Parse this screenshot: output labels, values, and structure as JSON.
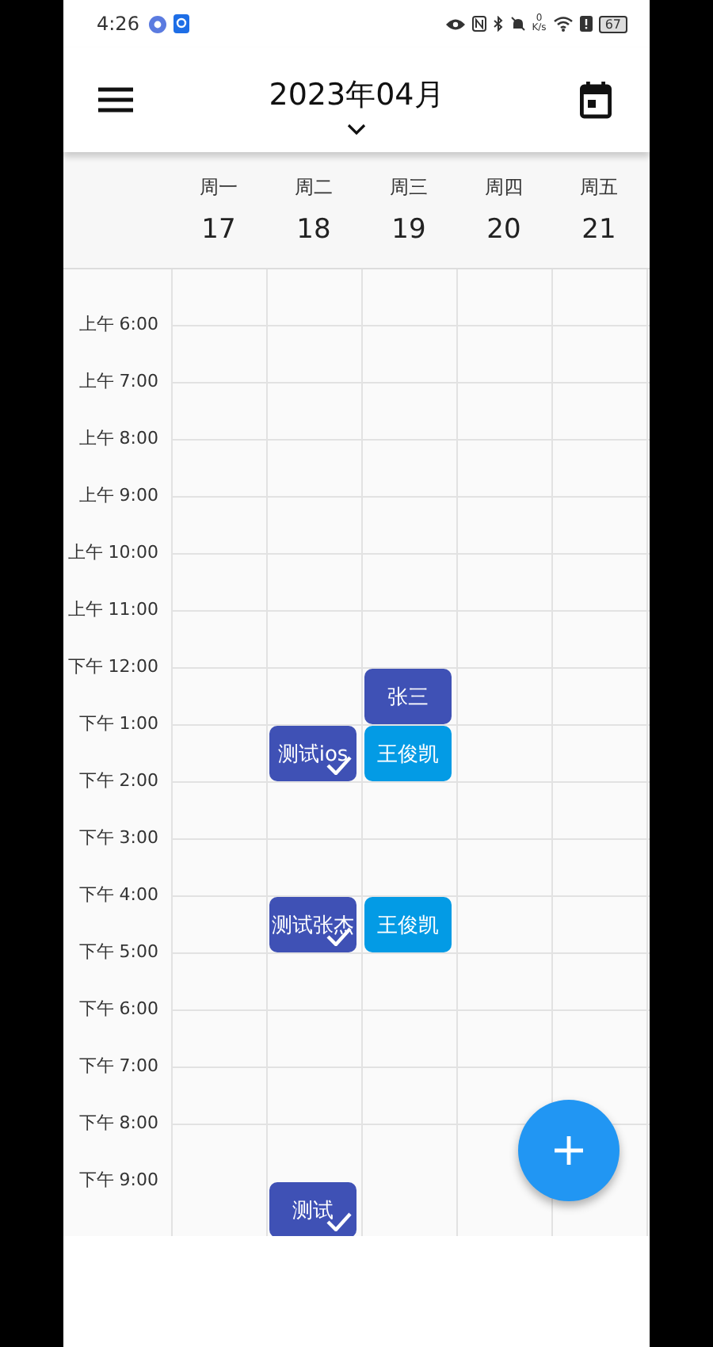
{
  "status_bar": {
    "time": "4:26",
    "speed_value": "0",
    "speed_unit": "K/s",
    "battery": "67"
  },
  "app_bar": {
    "title": "2023年04月"
  },
  "days": [
    {
      "weekday": "周一",
      "date": "17"
    },
    {
      "weekday": "周二",
      "date": "18"
    },
    {
      "weekday": "周三",
      "date": "19"
    },
    {
      "weekday": "周四",
      "date": "20"
    },
    {
      "weekday": "周五",
      "date": "21"
    }
  ],
  "hours": [
    {
      "label": "上午 6:00",
      "cells": [
        {
          "kind": "empty"
        },
        {
          "kind": "empty"
        },
        {
          "kind": "empty"
        },
        {
          "kind": "empty"
        },
        {
          "kind": "empty"
        }
      ]
    },
    {
      "label": "上午 7:00",
      "cells": [
        {
          "kind": "empty"
        },
        {
          "kind": "empty"
        },
        {
          "kind": "empty"
        },
        {
          "kind": "empty"
        },
        {
          "kind": "empty"
        }
      ]
    },
    {
      "label": "上午 8:00",
      "cells": [
        {
          "kind": "empty"
        },
        {
          "kind": "empty"
        },
        {
          "kind": "empty"
        },
        {
          "kind": "empty"
        },
        {
          "kind": "empty"
        }
      ]
    },
    {
      "label": "上午 9:00",
      "cells": [
        {
          "kind": "empty"
        },
        {
          "kind": "empty"
        },
        {
          "kind": "empty"
        },
        {
          "kind": "empty"
        },
        {
          "kind": "empty"
        }
      ]
    },
    {
      "label": "上午 10:00",
      "cells": [
        {
          "kind": "empty"
        },
        {
          "kind": "empty"
        },
        {
          "kind": "empty"
        },
        {
          "kind": "empty"
        },
        {
          "kind": "empty"
        }
      ]
    },
    {
      "label": "上午 11:00",
      "cells": [
        {
          "kind": "empty"
        },
        {
          "kind": "empty"
        },
        {
          "kind": "empty"
        },
        {
          "kind": "empty"
        },
        {
          "kind": "empty"
        }
      ]
    },
    {
      "label": "下午 12:00",
      "cells": [
        {
          "kind": "empty"
        },
        {
          "kind": "empty"
        },
        {
          "kind": "event",
          "title": "张三",
          "color": "#3f51b5",
          "done": false
        },
        {
          "kind": "empty"
        },
        {
          "kind": "empty"
        }
      ]
    },
    {
      "label": "下午 1:00",
      "cells": [
        {
          "kind": "empty"
        },
        {
          "kind": "event",
          "title": "测试ios",
          "color": "#3f51b5",
          "done": true
        },
        {
          "kind": "event",
          "title": "王俊凯",
          "color": "#039be5",
          "done": false
        },
        {
          "kind": "empty"
        },
        {
          "kind": "empty"
        }
      ]
    },
    {
      "label": "下午 2:00",
      "cells": [
        {
          "kind": "empty"
        },
        {
          "kind": "empty"
        },
        {
          "kind": "empty"
        },
        {
          "kind": "empty"
        },
        {
          "kind": "empty"
        }
      ]
    },
    {
      "label": "下午 3:00",
      "cells": [
        {
          "kind": "empty"
        },
        {
          "kind": "empty"
        },
        {
          "kind": "empty"
        },
        {
          "kind": "empty"
        },
        {
          "kind": "empty"
        }
      ]
    },
    {
      "label": "下午 4:00",
      "cells": [
        {
          "kind": "empty"
        },
        {
          "kind": "event",
          "title": "测试张杰",
          "color": "#3f51b5",
          "done": true
        },
        {
          "kind": "event",
          "title": "王俊凯",
          "color": "#039be5",
          "done": false
        },
        {
          "kind": "empty"
        },
        {
          "kind": "empty"
        }
      ]
    },
    {
      "label": "下午 5:00",
      "cells": [
        {
          "kind": "empty"
        },
        {
          "kind": "empty"
        },
        {
          "kind": "empty"
        },
        {
          "kind": "empty"
        },
        {
          "kind": "empty"
        }
      ]
    },
    {
      "label": "下午 6:00",
      "cells": [
        {
          "kind": "empty"
        },
        {
          "kind": "empty"
        },
        {
          "kind": "empty"
        },
        {
          "kind": "empty"
        },
        {
          "kind": "empty"
        }
      ]
    },
    {
      "label": "下午 7:00",
      "cells": [
        {
          "kind": "empty"
        },
        {
          "kind": "empty"
        },
        {
          "kind": "empty"
        },
        {
          "kind": "empty"
        },
        {
          "kind": "empty"
        }
      ]
    },
    {
      "label": "下午 8:00",
      "cells": [
        {
          "kind": "empty"
        },
        {
          "kind": "empty"
        },
        {
          "kind": "empty"
        },
        {
          "kind": "empty"
        },
        {
          "kind": "empty"
        }
      ]
    },
    {
      "label": "下午 9:00",
      "cells": [
        {
          "kind": "empty"
        },
        {
          "kind": "event",
          "title": "测试",
          "color": "#3f51b5",
          "done": true
        },
        {
          "kind": "empty"
        },
        {
          "kind": "empty"
        },
        {
          "kind": "empty"
        }
      ]
    }
  ]
}
